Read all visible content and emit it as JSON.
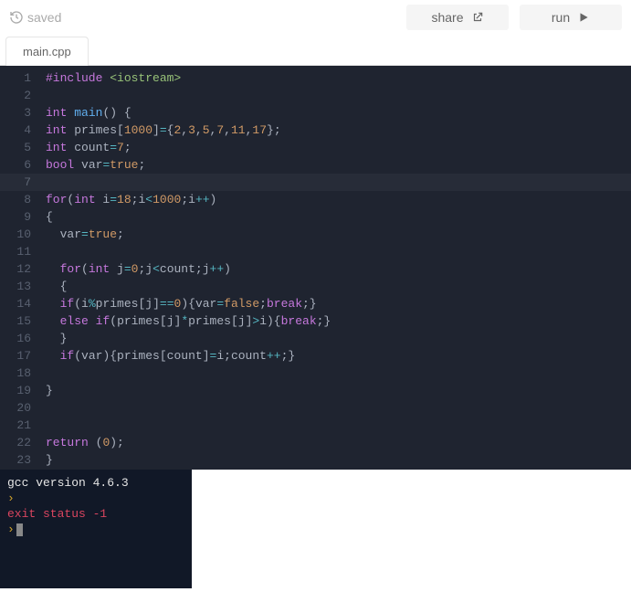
{
  "topbar": {
    "saved_label": "saved",
    "share_label": "share",
    "run_label": "run"
  },
  "tabs": {
    "active": "main.cpp"
  },
  "code": {
    "lines": [
      [
        [
          "pre",
          "#include "
        ],
        [
          "str",
          "<iostream>"
        ]
      ],
      [],
      [
        [
          "type",
          "int"
        ],
        [
          "id",
          " "
        ],
        [
          "fn",
          "main"
        ],
        [
          "pun",
          "()"
        ],
        [
          "id",
          " "
        ],
        [
          "pun",
          "{"
        ]
      ],
      [
        [
          "type",
          "int"
        ],
        [
          "id",
          " primes"
        ],
        [
          "pun",
          "["
        ],
        [
          "num",
          "1000"
        ],
        [
          "pun",
          "]"
        ],
        [
          "op",
          "="
        ],
        [
          "pun",
          "{"
        ],
        [
          "num",
          "2"
        ],
        [
          "pun",
          ","
        ],
        [
          "num",
          "3"
        ],
        [
          "pun",
          ","
        ],
        [
          "num",
          "5"
        ],
        [
          "pun",
          ","
        ],
        [
          "num",
          "7"
        ],
        [
          "pun",
          ","
        ],
        [
          "num",
          "11"
        ],
        [
          "pun",
          ","
        ],
        [
          "num",
          "17"
        ],
        [
          "pun",
          "};"
        ]
      ],
      [
        [
          "type",
          "int"
        ],
        [
          "id",
          " count"
        ],
        [
          "op",
          "="
        ],
        [
          "num",
          "7"
        ],
        [
          "pun",
          ";"
        ]
      ],
      [
        [
          "type",
          "bool"
        ],
        [
          "id",
          " var"
        ],
        [
          "op",
          "="
        ],
        [
          "bool",
          "true"
        ],
        [
          "pun",
          ";"
        ]
      ],
      [],
      [
        [
          "kw",
          "for"
        ],
        [
          "pun",
          "("
        ],
        [
          "type",
          "int"
        ],
        [
          "id",
          " i"
        ],
        [
          "op",
          "="
        ],
        [
          "num",
          "18"
        ],
        [
          "pun",
          ";"
        ],
        [
          "id",
          "i"
        ],
        [
          "op",
          "<"
        ],
        [
          "num",
          "1000"
        ],
        [
          "pun",
          ";"
        ],
        [
          "id",
          "i"
        ],
        [
          "op",
          "++"
        ],
        [
          "pun",
          ")"
        ]
      ],
      [
        [
          "pun",
          "{"
        ]
      ],
      [
        [
          "id",
          "  var"
        ],
        [
          "op",
          "="
        ],
        [
          "bool",
          "true"
        ],
        [
          "pun",
          ";"
        ]
      ],
      [],
      [
        [
          "id",
          "  "
        ],
        [
          "kw",
          "for"
        ],
        [
          "pun",
          "("
        ],
        [
          "type",
          "int"
        ],
        [
          "id",
          " j"
        ],
        [
          "op",
          "="
        ],
        [
          "num",
          "0"
        ],
        [
          "pun",
          ";"
        ],
        [
          "id",
          "j"
        ],
        [
          "op",
          "<"
        ],
        [
          "id",
          "count"
        ],
        [
          "pun",
          ";"
        ],
        [
          "id",
          "j"
        ],
        [
          "op",
          "++"
        ],
        [
          "pun",
          ")"
        ]
      ],
      [
        [
          "id",
          "  "
        ],
        [
          "pun",
          "{"
        ]
      ],
      [
        [
          "id",
          "  "
        ],
        [
          "kw",
          "if"
        ],
        [
          "pun",
          "("
        ],
        [
          "id",
          "i"
        ],
        [
          "op",
          "%"
        ],
        [
          "id",
          "primes"
        ],
        [
          "pun",
          "["
        ],
        [
          "id",
          "j"
        ],
        [
          "pun",
          "]"
        ],
        [
          "op",
          "=="
        ],
        [
          "num",
          "0"
        ],
        [
          "pun",
          "){"
        ],
        [
          "id",
          "var"
        ],
        [
          "op",
          "="
        ],
        [
          "bool",
          "false"
        ],
        [
          "pun",
          ";"
        ],
        [
          "kw",
          "break"
        ],
        [
          "pun",
          ";}"
        ]
      ],
      [
        [
          "id",
          "  "
        ],
        [
          "kw",
          "else"
        ],
        [
          "id",
          " "
        ],
        [
          "kw",
          "if"
        ],
        [
          "pun",
          "("
        ],
        [
          "id",
          "primes"
        ],
        [
          "pun",
          "["
        ],
        [
          "id",
          "j"
        ],
        [
          "pun",
          "]"
        ],
        [
          "op",
          "*"
        ],
        [
          "id",
          "primes"
        ],
        [
          "pun",
          "["
        ],
        [
          "id",
          "j"
        ],
        [
          "pun",
          "]"
        ],
        [
          "op",
          ">"
        ],
        [
          "id",
          "i"
        ],
        [
          "pun",
          "){"
        ],
        [
          "kw",
          "break"
        ],
        [
          "pun",
          ";}"
        ]
      ],
      [
        [
          "id",
          "  "
        ],
        [
          "pun",
          "}"
        ]
      ],
      [
        [
          "id",
          "  "
        ],
        [
          "kw",
          "if"
        ],
        [
          "pun",
          "("
        ],
        [
          "id",
          "var"
        ],
        [
          "pun",
          "){"
        ],
        [
          "id",
          "primes"
        ],
        [
          "pun",
          "["
        ],
        [
          "id",
          "count"
        ],
        [
          "pun",
          "]"
        ],
        [
          "op",
          "="
        ],
        [
          "id",
          "i"
        ],
        [
          "pun",
          ";"
        ],
        [
          "id",
          "count"
        ],
        [
          "op",
          "++"
        ],
        [
          "pun",
          ";}"
        ]
      ],
      [],
      [
        [
          "pun",
          "}"
        ]
      ],
      [],
      [],
      [
        [
          "kw",
          "return"
        ],
        [
          "id",
          " "
        ],
        [
          "pun",
          "("
        ],
        [
          "num",
          "0"
        ],
        [
          "pun",
          ");"
        ]
      ],
      [
        [
          "pun",
          "}"
        ]
      ]
    ],
    "highlight_line": 7
  },
  "terminal": {
    "lines": [
      {
        "cls": "white",
        "text": "gcc version 4.6.3"
      },
      {
        "cls": "yellow",
        "text": "   "
      },
      {
        "cls": "red",
        "text": "exit status -1"
      },
      {
        "cls": "yellow",
        "text": "   ",
        "cursor": true
      }
    ]
  }
}
